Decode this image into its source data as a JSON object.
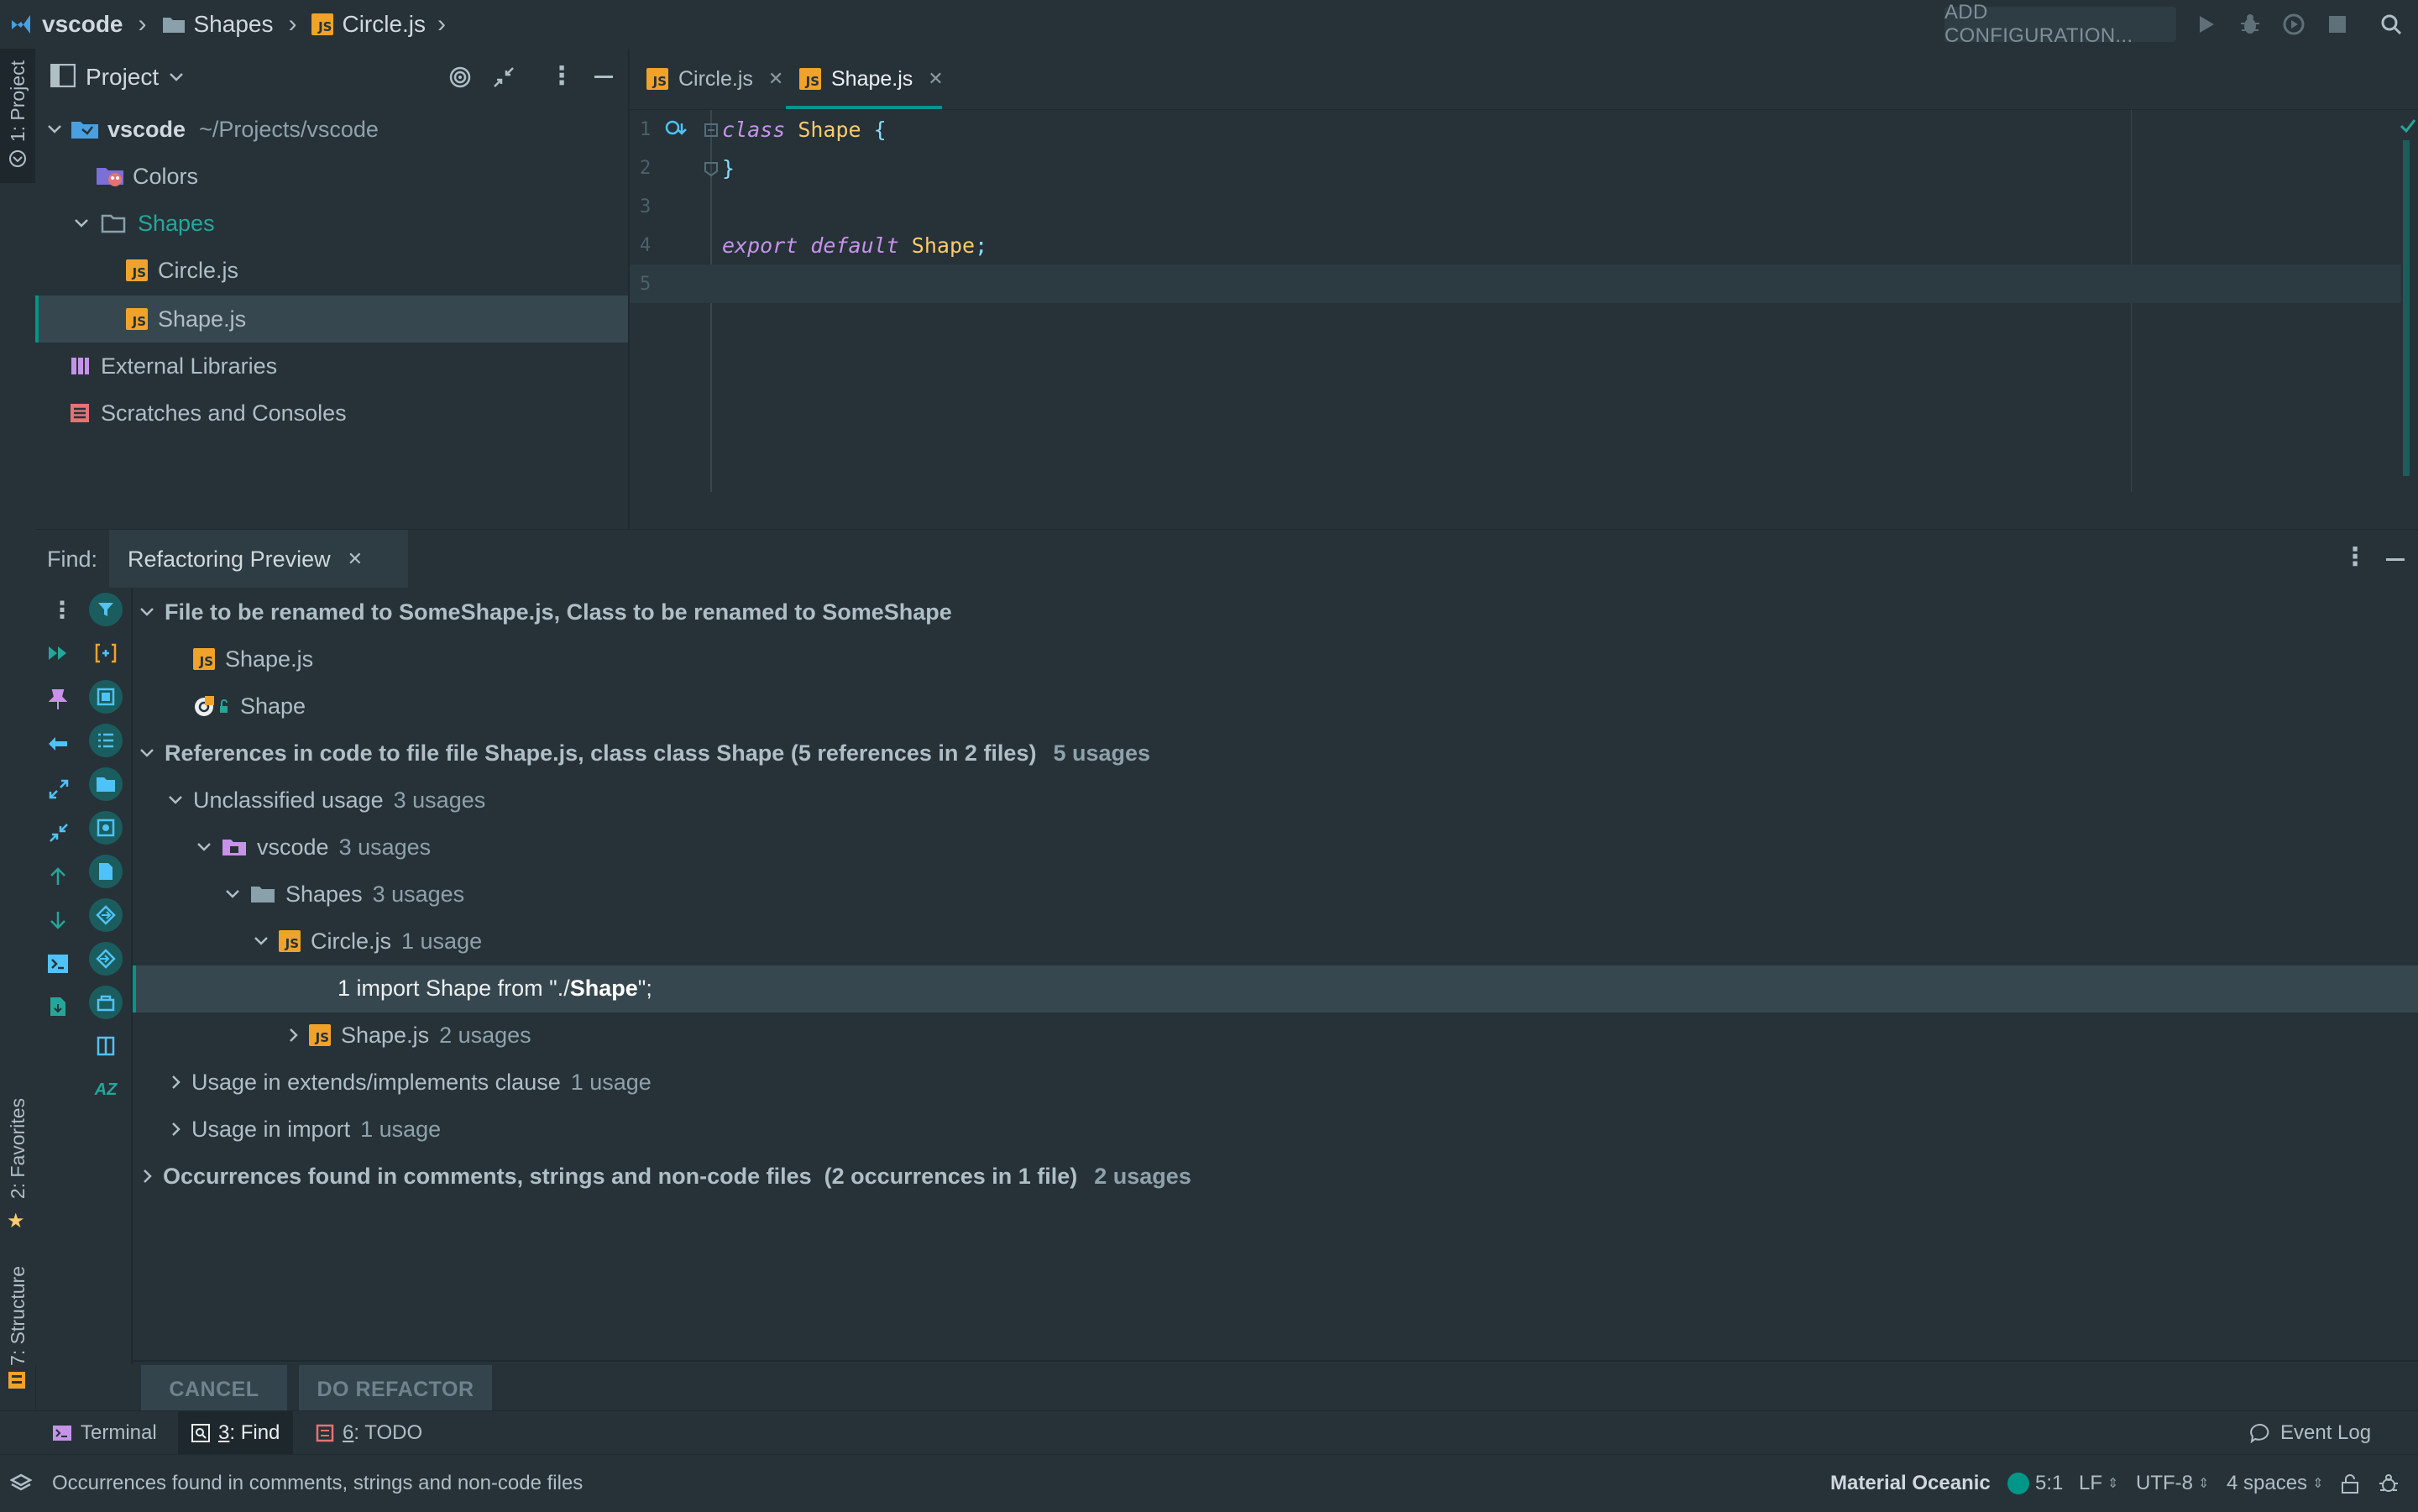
{
  "colors": {
    "background": "#263238",
    "accent": "#009688",
    "text": "#b0bec5",
    "keyword": "#c792ea",
    "class_name": "#ffcb6b",
    "punctuation": "#89ddff",
    "js_icon": "#f0a22b",
    "selection": "#37474f"
  },
  "breadcrumb": {
    "project": "vscode",
    "folder": "Shapes",
    "file": "Circle.js"
  },
  "toolbar": {
    "add_configuration": "ADD CONFIGURATION...",
    "icons": [
      "run-icon",
      "debug-icon",
      "coverage-icon",
      "stop-icon",
      "search-icon"
    ]
  },
  "left_stripe": {
    "project_tab": "1: Project",
    "favorites_tab": "2: Favorites",
    "structure_tab": "7: Structure"
  },
  "project_panel": {
    "title": "Project",
    "root_name": "vscode",
    "root_path": "~/Projects/vscode",
    "items": [
      {
        "label": "Colors"
      },
      {
        "label": "Shapes"
      },
      {
        "label": "Circle.js"
      },
      {
        "label": "Shape.js"
      },
      {
        "label": "External Libraries"
      },
      {
        "label": "Scratches and Consoles"
      }
    ]
  },
  "editor": {
    "tabs": [
      {
        "label": "Circle.js",
        "active": false
      },
      {
        "label": "Shape.js",
        "active": true
      }
    ],
    "line_numbers": [
      "1",
      "2",
      "3",
      "4",
      "5"
    ],
    "code": {
      "l1_kw": "class",
      "l1_name": "Shape",
      "l1_brace": "{",
      "l2_brace": "}",
      "l4_kw1": "export",
      "l4_kw2": "default",
      "l4_name": "Shape",
      "l4_semi": ";"
    }
  },
  "find": {
    "label": "Find:",
    "tab": "Refactoring Preview",
    "tree": {
      "rename_header": "File to be renamed to SomeShape.js, Class to be renamed to SomeShape",
      "rename_file": "Shape.js",
      "rename_class": "Shape",
      "refs_header": "References in code to file file Shape.js, class class Shape (5 references in 2 files)",
      "refs_count": "5 usages",
      "unclassified": "Unclassified usage",
      "unclassified_count": "3 usages",
      "vscode": "vscode",
      "vscode_count": "3 usages",
      "shapes": "Shapes",
      "shapes_count": "3 usages",
      "circle": "Circle.js",
      "circle_count": "1 usage",
      "usage_line_prefix": "1 import Shape from \"./",
      "usage_line_match": "Shape",
      "usage_line_suffix": "\";",
      "shape_file": "Shape.js",
      "shape_file_count": "2 usages",
      "extends": "Usage in extends/implements clause",
      "extends_count": "1 usage",
      "import": "Usage in import",
      "import_count": "1 usage",
      "occurrences": "Occurrences found in comments, strings and non-code files  (2 occurrences in 1 file)",
      "occurrences_count": "2 usages"
    },
    "cancel": "CANCEL",
    "do_refactor": "DO REFACTOR"
  },
  "bottom_tools": {
    "terminal": "Terminal",
    "find_num": "3",
    "find": ": Find",
    "todo_num": "6",
    "todo": ": TODO",
    "event_log": "Event Log"
  },
  "status": {
    "message": "Occurrences found in comments, strings and non-code files",
    "theme": "Material Oceanic",
    "position": "5:1",
    "line_sep": "LF",
    "encoding": "UTF-8",
    "indent": "4 spaces"
  }
}
